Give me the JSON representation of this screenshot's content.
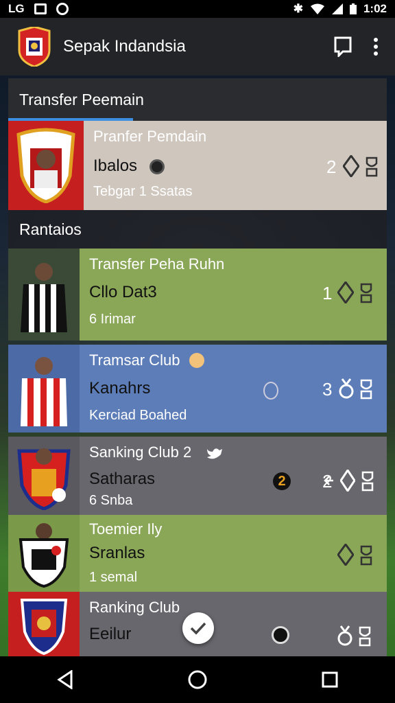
{
  "status": {
    "left_icons": [
      "LG",
      "stop-icon",
      "data-saver-icon"
    ],
    "time": "1:02"
  },
  "app": {
    "title": "Sepak Indandsia"
  },
  "section1": {
    "title": "Transfer Peemain"
  },
  "featured": {
    "title": "Pranfer Pemdain",
    "name": "Ibalos",
    "sub": "Tebgar 1 Ssatas",
    "number": "2"
  },
  "section2": {
    "title": "Rantaios"
  },
  "cards": [
    {
      "title": "Transfer Peha Ruhn",
      "name": "Cllo Dat3",
      "sub": "6 Irimar",
      "number": "1"
    },
    {
      "title": "Tramsar Club",
      "name": "Kanahrs",
      "sub": "Kerciad Boahed",
      "number": "3"
    },
    {
      "title": "Sanking Club 2",
      "name": "Satharas",
      "sub": "6 Snba",
      "number": "2"
    },
    {
      "title": "Toemier Ily",
      "name": "Sranlas",
      "sub": "1 semal",
      "number": ""
    },
    {
      "title": "Ranking Club",
      "name": "Eeilur",
      "sub": "",
      "number": ""
    }
  ],
  "colors": {
    "appbar": "#232427",
    "featured_bg": "#cfc7be",
    "green_card": "#8aa657",
    "blue_card": "#5d7db8",
    "grey_card": "#68676d",
    "accent": "#3c8fe0"
  }
}
